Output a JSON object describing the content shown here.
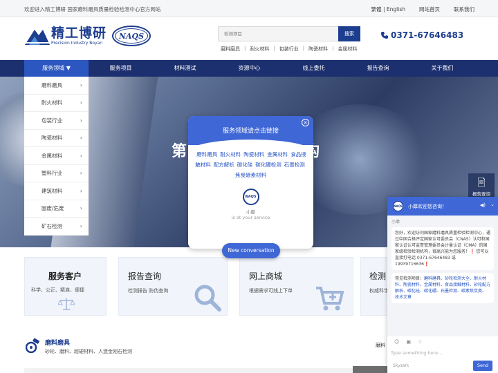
{
  "topbar": {
    "welcome": "欢迎进入精工博研 国家磨料磨具质量检验检测中心官方网站",
    "links": [
      "繁體 | English",
      "网站首页",
      "联系我们"
    ]
  },
  "header": {
    "logo_cn": "精工博研",
    "logo_en": "Precision Industry Boyan",
    "naqs": "NAQS",
    "search_placeholder": "检测项目",
    "search_button": "搜索",
    "hot_links": [
      "磨料磨具",
      "耐火材料",
      "包装行业",
      "陶瓷材料",
      "金属材料"
    ],
    "phone": "0371-67646483"
  },
  "nav": {
    "items": [
      "服务领域",
      "服务项目",
      "材料测试",
      "资源中心",
      "线上委托",
      "报告查询",
      "关于我们"
    ]
  },
  "sidemenu": {
    "items": [
      "磨料磨具",
      "耐火材料",
      "包装行业",
      "陶瓷材料",
      "金属材料",
      "塑料行业",
      "建筑材料",
      "固废/危废",
      "矿石检测"
    ]
  },
  "banner": {
    "title_left": "第",
    "title_right": "构"
  },
  "popup": {
    "title": "服务领域请点击链接",
    "links": [
      "磨料磨具",
      "耐火材料",
      "陶瓷材料",
      "金属材料",
      "食品接触材料",
      "配方解析",
      "碳化硅",
      "碳化硼检测",
      "石墨检测",
      "焦炭碳素材料"
    ],
    "avatar": "NAQS",
    "name": "小靡",
    "sub": "is at your service",
    "button": "New conversation"
  },
  "cards": [
    {
      "title": "服务客户",
      "sub": "科学、公正、精准、便捷"
    },
    {
      "title": "报告查询",
      "sub": "检测报告 防伪查询"
    },
    {
      "title": "网上商城",
      "sub": "根据需求可线上下单"
    },
    {
      "title": "检测",
      "sub": "权威科学"
    }
  ],
  "products": {
    "title": "磨料磨具",
    "sub": "砂轮、磨料、超硬材料、人造金刚石检测",
    "right_label": "磨料"
  },
  "rightbar": {
    "label": "报告查询"
  },
  "chat": {
    "header": "小靡欢迎您咨询！",
    "agent": "小靡",
    "msg1": "您好，欢迎访问国家磨料磨具质量检验检测中心，通过中国合格评定国家认可委员会（CNAS）认可和国家认证认可监督管理委员会计量认证（CMA）的国家级检验检测机构，很高兴能为您服务！❗ 您可以直接打电话 0371-67646483 或 19939716636❗",
    "msg2_prefix": "常见检测项目：",
    "msg2_links": "磨料磨具、砂轮检测大全、耐火材料、陶瓷材料、金属材料、食品接触材料、砂轮配方解析、碳化硅、碳化硼、石墨检测、碳素焦炭类、",
    "msg2_more": "技术文章",
    "input_placeholder": "Type something here...",
    "brand": "Skysark",
    "send": "Send"
  },
  "colors": {
    "primary": "#1d3d8f",
    "nav_bg": "#1c2f6e",
    "accent": "#3f67d6"
  }
}
